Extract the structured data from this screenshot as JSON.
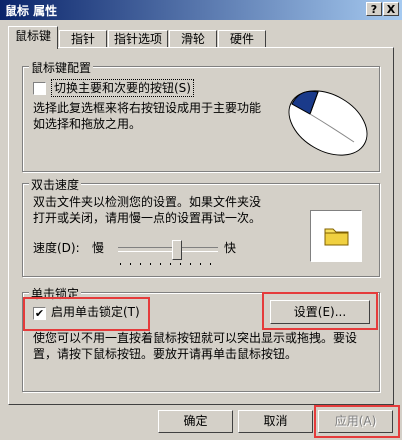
{
  "window": {
    "title": "鼠标 属性",
    "help_btn": "?",
    "close_btn": "X"
  },
  "tabs": [
    "鼠标键",
    "指针",
    "指针选项",
    "滑轮",
    "硬件"
  ],
  "buttons_config": {
    "title": "鼠标键配置",
    "switch_label": "切换主要和次要的按钮(S)",
    "switch_checked": false,
    "description": [
      "选择此复选框来将右按钮设成用于主要功能",
      "如选择和拖放之用。"
    ]
  },
  "double_click": {
    "title": "双击速度",
    "description": [
      "双击文件夹以检测您的设置。如果文件夹没",
      "打开或关闭，请用慢一点的设置再试一次。"
    ],
    "speed_label": "速度(D):",
    "slow": "慢",
    "fast": "快",
    "speed_fraction": 0.6
  },
  "click_lock": {
    "title": "单击锁定",
    "enable_label": "启用单击锁定(T)",
    "enable_checked": true,
    "settings_button": "设置(E)...",
    "description": [
      "使您可以不用一直按着鼠标按钮就可以突出显示或拖拽。要设",
      "置，请按下鼠标按钮。要放开请再单击鼠标按钮。"
    ]
  },
  "footer": {
    "ok": "确定",
    "cancel": "取消",
    "apply": "应用(A)"
  },
  "colors": {
    "highlight": "#e53b3b",
    "titlebar": "#0a246a",
    "mouse_accent": "#1a3a8a"
  },
  "icons": [
    "mouse-illustration",
    "folder-icon"
  ]
}
